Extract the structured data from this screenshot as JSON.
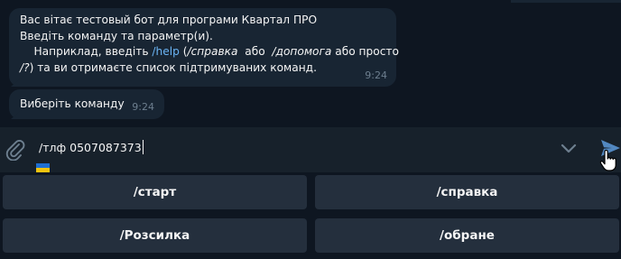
{
  "messages": [
    {
      "line1": "Вас вітає тестовый бот для програми Квартал ПРО",
      "line2": "Введіть команду та параметр(и).",
      "line3": {
        "prefix": "    Наприклад, введіть ",
        "help_link": "/help",
        "open": " (",
        "cmd1": "/справка",
        "sep": "  або  ",
        "cmd2": "/допомога",
        "suffix": " або просто"
      },
      "line4": {
        "cmd3": "/?",
        "suffix": ") та ви отримаєте список підтримуваних команд."
      },
      "time": "9:24"
    },
    {
      "text": "Виберіть команду",
      "time": "9:24"
    }
  ],
  "input": {
    "value": "/тлф 0507087373"
  },
  "icons": {
    "attach": "paperclip-icon",
    "keyboard_toggle": "chevron-down-icon",
    "send": "send-icon",
    "layout_flag": "ukraine-flag-icon",
    "cursor": "hand-pointer-icon"
  },
  "keyboard": {
    "buttons": [
      "/старт",
      "/справка",
      "/Розсилка",
      "/обране"
    ]
  },
  "colors": {
    "background": "#0e1621",
    "bubble": "#182533",
    "input_bar": "#17212b",
    "button": "#242f3d",
    "link": "#6ab3f3",
    "send": "#5288c1"
  }
}
